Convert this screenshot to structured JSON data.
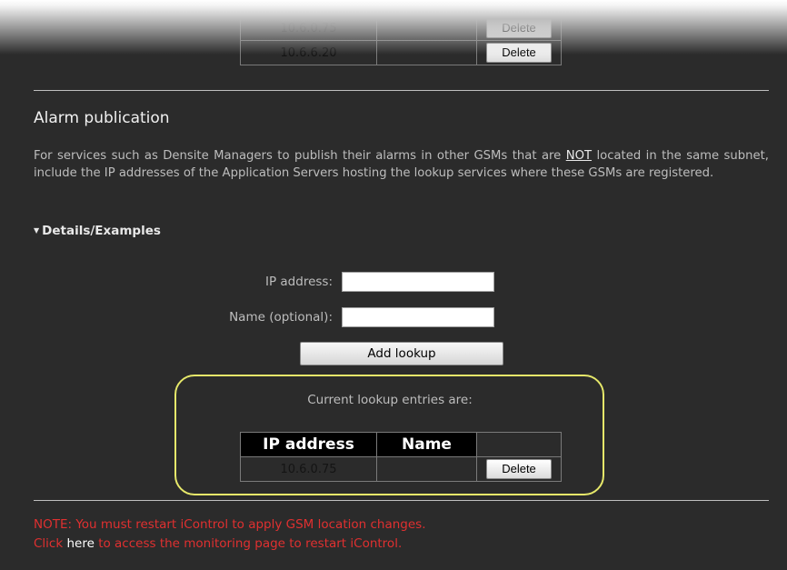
{
  "upper_table": {
    "rows": [
      {
        "ip": "10.6.0.75",
        "name": "",
        "action": "Delete"
      },
      {
        "ip": "10.6.6.20",
        "name": "",
        "action": "Delete"
      }
    ]
  },
  "section": {
    "title": "Alarm publication",
    "desc_before": "For services such as Densite Managers to publish their alarms in other GSMs that are ",
    "desc_emph": "NOT",
    "desc_after": " located in the same subnet, include the IP addresses of the Application Servers hosting the lookup services where these GSMs are registered.",
    "details_label": "Details/Examples"
  },
  "form": {
    "ip_label": "IP address:",
    "ip_value": "",
    "name_label": "Name (optional):",
    "name_value": "",
    "add_button": "Add lookup"
  },
  "lookup": {
    "caption": "Current lookup entries are:",
    "headers": [
      "IP address",
      "Name"
    ],
    "rows": [
      {
        "ip": "10.6.0.75",
        "name": "",
        "action": "Delete"
      }
    ]
  },
  "note": {
    "line1": "NOTE: You must restart iControl to apply GSM location changes.",
    "click": "Click",
    "here": "here",
    "line2_rest": "to access the monitoring page to restart iControl."
  },
  "colors": {
    "background": "#2b2b2b",
    "highlight": "#e6e86a",
    "note_red": "#e03030"
  }
}
